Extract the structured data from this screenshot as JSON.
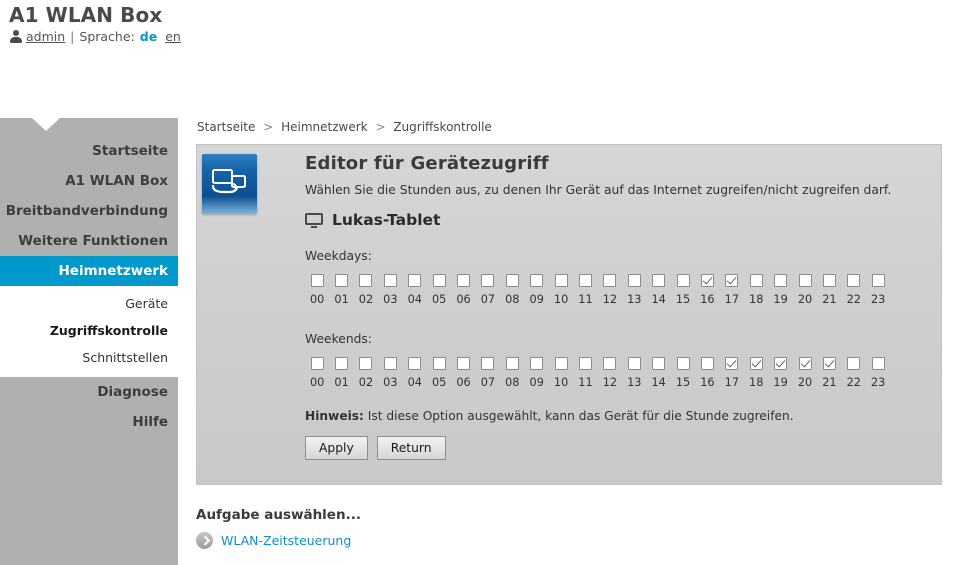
{
  "header": {
    "brand_title": "A1 WLAN Box",
    "user_icon": "user-icon",
    "user_name": "admin",
    "separator": "|",
    "language_label": "Sprache:",
    "lang_de": "de",
    "lang_en": "en"
  },
  "sidebar": {
    "top_items": [
      {
        "label": "Startseite",
        "active": false
      },
      {
        "label": "A1 WLAN Box",
        "active": false
      },
      {
        "label": "Breitbandverbindung",
        "active": false
      },
      {
        "label": "Weitere Funktionen",
        "active": false
      },
      {
        "label": "Heimnetzwerk",
        "active": true
      }
    ],
    "sub_items": [
      {
        "label": "Geräte",
        "current": false
      },
      {
        "label": "Zugriffskontrolle",
        "current": true
      },
      {
        "label": "Schnittstellen",
        "current": false
      }
    ],
    "bottom_items": [
      {
        "label": "Diagnose",
        "active": false
      },
      {
        "label": "Hilfe",
        "active": false
      }
    ],
    "active_color": "#0099cc"
  },
  "breadcrumb": {
    "items": [
      "Startseite",
      "Heimnetzwerk",
      "Zugriffskontrolle"
    ],
    "separator": ">"
  },
  "panel": {
    "icon": "network-computer-icon",
    "title": "Editor für Gerätezugriff",
    "description": "Wählen Sie die Stunden aus, zu denen Ihr Gerät auf das Internet zugreifen/nicht zugreifen darf.",
    "device_icon": "monitor-icon",
    "device_name": "Lukas-Tablet",
    "weekdays_label": "Weekdays:",
    "weekends_label": "Weekends:",
    "hours": [
      "00",
      "01",
      "02",
      "03",
      "04",
      "05",
      "06",
      "07",
      "08",
      "09",
      "10",
      "11",
      "12",
      "13",
      "14",
      "15",
      "16",
      "17",
      "18",
      "19",
      "20",
      "21",
      "22",
      "23"
    ],
    "weekdays_checked": [
      false,
      false,
      false,
      false,
      false,
      false,
      false,
      false,
      false,
      false,
      false,
      false,
      false,
      false,
      false,
      false,
      true,
      true,
      false,
      false,
      false,
      false,
      false,
      false
    ],
    "weekends_checked": [
      false,
      false,
      false,
      false,
      false,
      false,
      false,
      false,
      false,
      false,
      false,
      false,
      false,
      false,
      false,
      false,
      false,
      true,
      true,
      true,
      true,
      true,
      false,
      false
    ],
    "hint_bold": "Hinweis:",
    "hint_text": " Ist diese Option ausgewählt, kann das Gerät für die Stunde zugreifen.",
    "apply_label": "Apply",
    "return_label": "Return"
  },
  "task_section": {
    "title": "Aufgabe auswählen...",
    "link_icon": "chevron-right-circle-icon",
    "link_label": "WLAN-Zeitsteuerung",
    "link_color": "#0e8fc4"
  }
}
